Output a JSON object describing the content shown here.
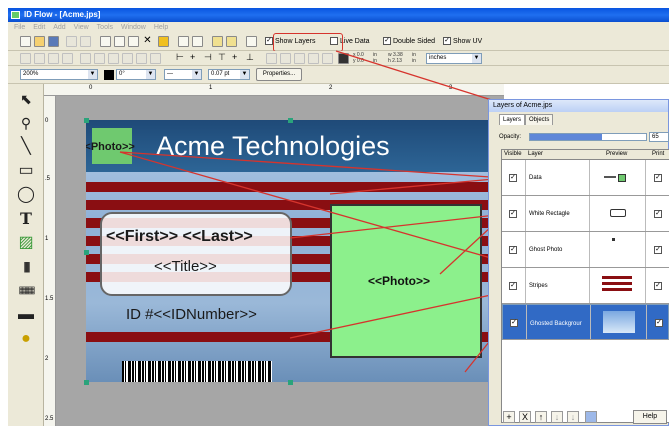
{
  "window": {
    "title": "ID Flow - [Acme.jps]"
  },
  "menu": [
    "File",
    "Edit",
    "Add",
    "View",
    "Tools",
    "Window",
    "Help"
  ],
  "toolbar": {
    "show_layers": "Show Layers",
    "live_data": "Live Data",
    "double_sided": "Double Sided",
    "show_uv": "Show UV",
    "coords": {
      "x": "x 0.0",
      "y": "y 0.0",
      "w": "w 3.38",
      "h": "h 2.13",
      "in1": "in",
      "in2": "in",
      "in3": "in",
      "in4": "in"
    },
    "units": "inches",
    "zoom": "200%",
    "rotation": "0°",
    "line_width": "0.07 pt",
    "properties": "Properties..."
  },
  "ruler": {
    "top_ticks": [
      "0",
      "1",
      "2",
      "3"
    ],
    "left_ticks": [
      "0",
      ".5",
      "1",
      "1.5",
      "2",
      "2.5"
    ]
  },
  "card": {
    "company": "Acme Technologies",
    "photo_small": "<<Photo>>",
    "name": "<<First>> <<Last>>",
    "title": "<<Title>>",
    "id": "ID #<<IDNumber>>",
    "photo": "<<Photo>>"
  },
  "layers": {
    "title": "Layers of Acme.jps",
    "tabs": [
      "Layers",
      "Objects"
    ],
    "opacity_label": "Opacity:",
    "opacity_value": "65",
    "opacity_level": 0.62,
    "columns": [
      "Visible",
      "Layer",
      "Preview",
      "Print"
    ],
    "rows": [
      {
        "name": "Data",
        "visible": true,
        "print": true,
        "selected": false
      },
      {
        "name": "White Rectagle",
        "visible": true,
        "print": true,
        "selected": false
      },
      {
        "name": "Ghost Photo",
        "visible": true,
        "print": true,
        "selected": false
      },
      {
        "name": "Stripes",
        "visible": true,
        "print": true,
        "selected": false
      },
      {
        "name": "Ghosted Backgrour",
        "visible": true,
        "print": true,
        "selected": true
      }
    ],
    "buttons": [
      "+",
      "X",
      "↑",
      "↓",
      "↓"
    ],
    "help": "Help"
  },
  "colors": {
    "accent": "#d6342d",
    "title_bar": "#0a54e0",
    "photo_green": "#8cf08c",
    "stripe_red": "#8a0e12",
    "selection": "#316ac5"
  }
}
